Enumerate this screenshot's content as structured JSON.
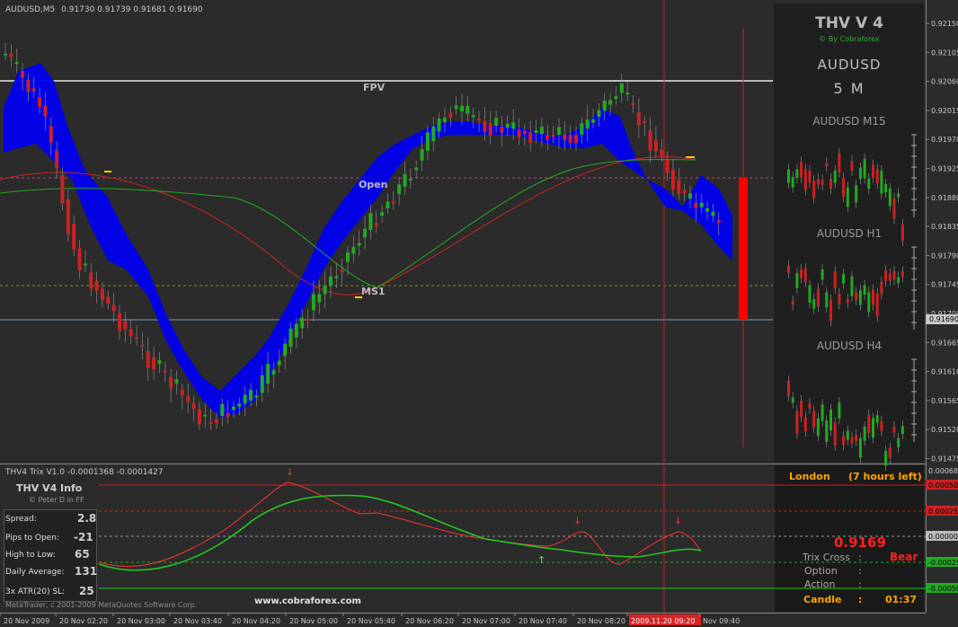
{
  "window": {
    "symbol_title": "AUDUSD,M5",
    "ohlc": "0.91730 0.91739 0.91681 0.91690",
    "copyright": "MetaTrader, c 2001-2009 MetaQuotes Software Corp.",
    "website": "www.cobraforex.com"
  },
  "price_axis": {
    "labels": [
      "0.92150",
      "0.92105",
      "0.92060",
      "0.92015",
      "0.91970",
      "0.91925",
      "0.91880",
      "0.91835",
      "0.91790",
      "0.91745",
      "0.91700",
      "0.91665",
      "0.91610",
      "0.91565",
      "0.91520",
      "0.91475"
    ],
    "current_price": "0.91690"
  },
  "time_axis": {
    "labels": [
      "20 Nov 2009",
      "20 Nov 02:20",
      "20 Nov 03:00",
      "20 Nov 03:40",
      "20 Nov 04:20",
      "20 Nov 05:00",
      "20 Nov 05:40",
      "20 Nov 06:20",
      "20 Nov 07:00",
      "20 Nov 07:40",
      "20 Nov 08:20",
      "2009.11.20 09:20",
      "Nov 09:40"
    ]
  },
  "chart_labels": {
    "fpv": "FPV",
    "open": "Open",
    "ms1": "MS1"
  },
  "right_panel": {
    "title": "THV V 4",
    "byline": "© By Cobraforex",
    "symbol": "AUDUSD",
    "timeframe": "5 M",
    "mini_charts": [
      {
        "label": "AUDUSD M15"
      },
      {
        "label": "AUDUSD H1"
      },
      {
        "label": "AUDUSD H4"
      }
    ]
  },
  "indicator": {
    "title": "THV4 Trix V1.0 -0.0001368 -0.0001427",
    "axis_labels": [
      "0.000684",
      "0.000500",
      "0.000250",
      "0.00000",
      "-0.000250",
      "-0.000500"
    ]
  },
  "info_panel": {
    "title": "THV  V4  Info",
    "subtitle": "© Peter D in FF",
    "rows": [
      {
        "label": "Spread:",
        "value": "2.8",
        "color": "#ffa500"
      },
      {
        "label": "Pips to Open:",
        "value": "-21",
        "color": "#ff4040"
      },
      {
        "label": "High to Low:",
        "value": "65",
        "color": "#33cc33"
      },
      {
        "label": "Daily Average:",
        "value": "131",
        "color": "#33cc33"
      },
      {
        "label": "3x ATR(20) SL:",
        "value": "25",
        "color": "#ffa500"
      }
    ]
  },
  "session": {
    "name": "London",
    "time_left": "(7 hours left)"
  },
  "status": {
    "price": "0.9169",
    "trix_cross_label": "Trix Cross",
    "trix_cross_value": "Bear",
    "option_label": "Option",
    "action_label": "Action",
    "candle_label": "Candle",
    "colon": ":",
    "candle_time": "01:37"
  },
  "colors": {
    "bull": "#22aa22",
    "bear": "#cc2222",
    "cloud": "#0000ee",
    "background": "#2b2b2b",
    "panel": "#232323"
  }
}
